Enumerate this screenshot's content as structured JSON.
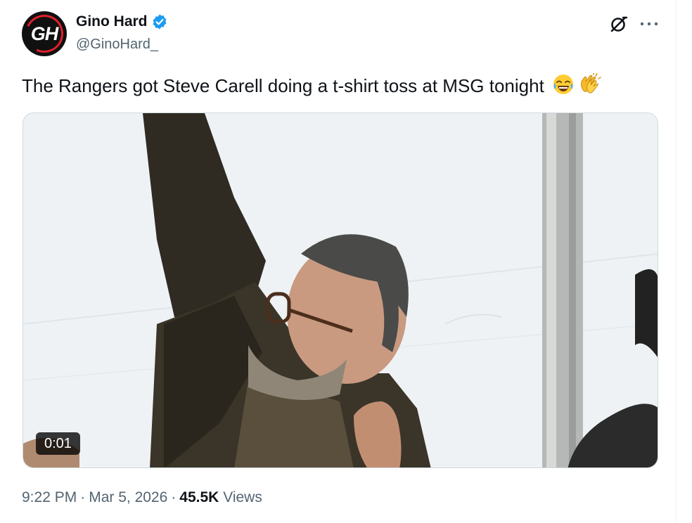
{
  "author": {
    "display_name": "Gino Hard",
    "handle": "@GinoHard_",
    "avatar_initials": "GH",
    "verified": true,
    "brand_colors": {
      "verified_badge": "#1d9bf0",
      "avatar_bg": "#101010",
      "avatar_accent": "#e0202a"
    }
  },
  "header_actions": {
    "grok_icon": "grok-icon",
    "more_icon": "more-horizontal-icon"
  },
  "tweet": {
    "text": "The Rangers got Steve Carell doing a t-shirt toss at MSG tonight",
    "emojis": [
      "face-with-tears-of-joy",
      "clapping-hands"
    ]
  },
  "media": {
    "type": "video",
    "duration": "0:01"
  },
  "meta": {
    "time": "9:22 PM",
    "separator": "·",
    "date": "Mar 5, 2026",
    "views_count": "45.5K",
    "views_label": "Views"
  },
  "colors": {
    "primary_text": "#0f1419",
    "secondary_text": "#536471",
    "border": "#cfd9de"
  }
}
